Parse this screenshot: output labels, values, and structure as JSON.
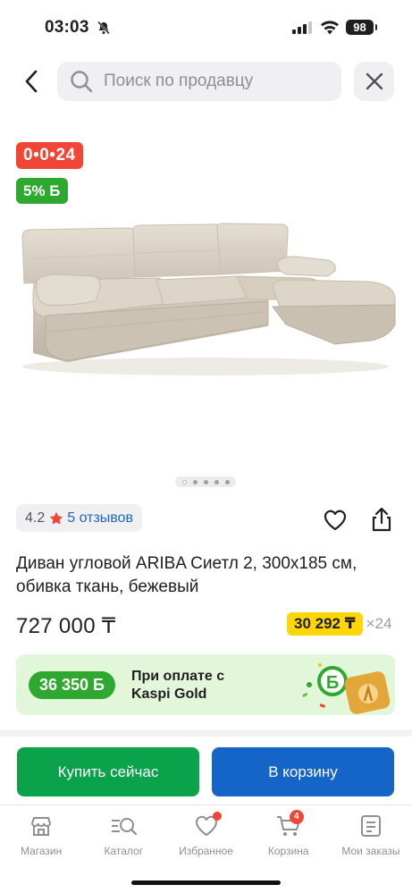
{
  "status_bar": {
    "time": "03:03",
    "battery": "98"
  },
  "search": {
    "placeholder": "Поиск по продавцу"
  },
  "badges": {
    "promo": "0•0•24",
    "bonus": "5% Б"
  },
  "carousel": {
    "count": 5,
    "active_index": 0
  },
  "rating": {
    "value": "4.2",
    "reviews": "5 отзывов"
  },
  "product": {
    "title": "Диван угловой ARIBA Сиетл 2, 300x185 см, обивка ткань, бежевый",
    "price": "727 000 ₸",
    "installment_amount": "30 292 ₸",
    "installment_months": "×24"
  },
  "kaspi_gold": {
    "bonus": "36 350 Б",
    "text": "При оплате с Kaspi Gold"
  },
  "actions": {
    "buy_now": "Купить сейчас",
    "add_to_cart": "В корзину"
  },
  "tabs": [
    {
      "label": "Магазин",
      "icon": "shop-icon"
    },
    {
      "label": "Каталог",
      "icon": "catalog-search-icon"
    },
    {
      "label": "Избранное",
      "icon": "heart-icon"
    },
    {
      "label": "Корзина",
      "icon": "cart-icon",
      "badge": "4"
    },
    {
      "label": "Мои заказы",
      "icon": "orders-icon"
    }
  ],
  "colors": {
    "promo_red": "#f14635",
    "bonus_green": "#2fa82f",
    "buy_green": "#0aa24b",
    "cart_blue": "#1565c8",
    "installment_yellow": "#ffd60a",
    "link_blue": "#1a67c5"
  }
}
